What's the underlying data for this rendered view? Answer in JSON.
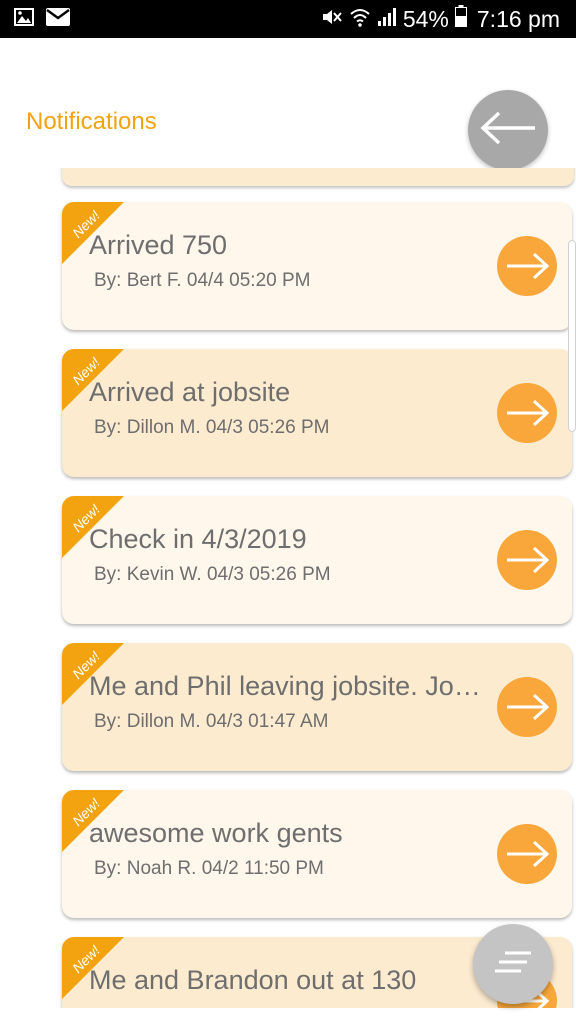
{
  "status_bar": {
    "left_icons": [
      "gallery-icon",
      "mail-icon"
    ],
    "right_icons": [
      "mute-icon",
      "wifi-icon",
      "signal-icon",
      "battery-icon"
    ],
    "battery_percent": "54%",
    "time": "7:16 pm"
  },
  "header": {
    "title": "Notifications",
    "back_icon": "arrow-left-icon"
  },
  "colors": {
    "accent": "#f2a30f",
    "ribbon": "#f2a30f",
    "go_button": "#f9a73b",
    "card_light": "#fff6ec",
    "card_dark": "#fdebd0",
    "fab": "#c4c4c4"
  },
  "notifications": [
    {
      "badge": "New!",
      "title": "Arrived 750",
      "byline": "By: Bert F. 04/4 05:20 PM",
      "variant": "light"
    },
    {
      "badge": "New!",
      "title": "Arrived at jobsite",
      "byline": "By: Dillon M. 04/3 05:26 PM",
      "variant": "dark"
    },
    {
      "badge": "New!",
      "title": "Check in 4/3/2019",
      "byline": "By: Kevin W. 04/3 05:26 PM",
      "variant": "light"
    },
    {
      "badge": "New!",
      "title": "Me and Phil leaving jobsite. Job c…",
      "byline": "By: Dillon M. 04/3 01:47 AM",
      "variant": "dark"
    },
    {
      "badge": "New!",
      "title": "awesome work gents",
      "byline": "By: Noah R. 04/2 11:50 PM",
      "variant": "light"
    },
    {
      "badge": "New!",
      "title": "Me and Brandon out at 130",
      "byline": "",
      "variant": "dark"
    }
  ],
  "menu_fab_icon": "menu-lines-icon"
}
